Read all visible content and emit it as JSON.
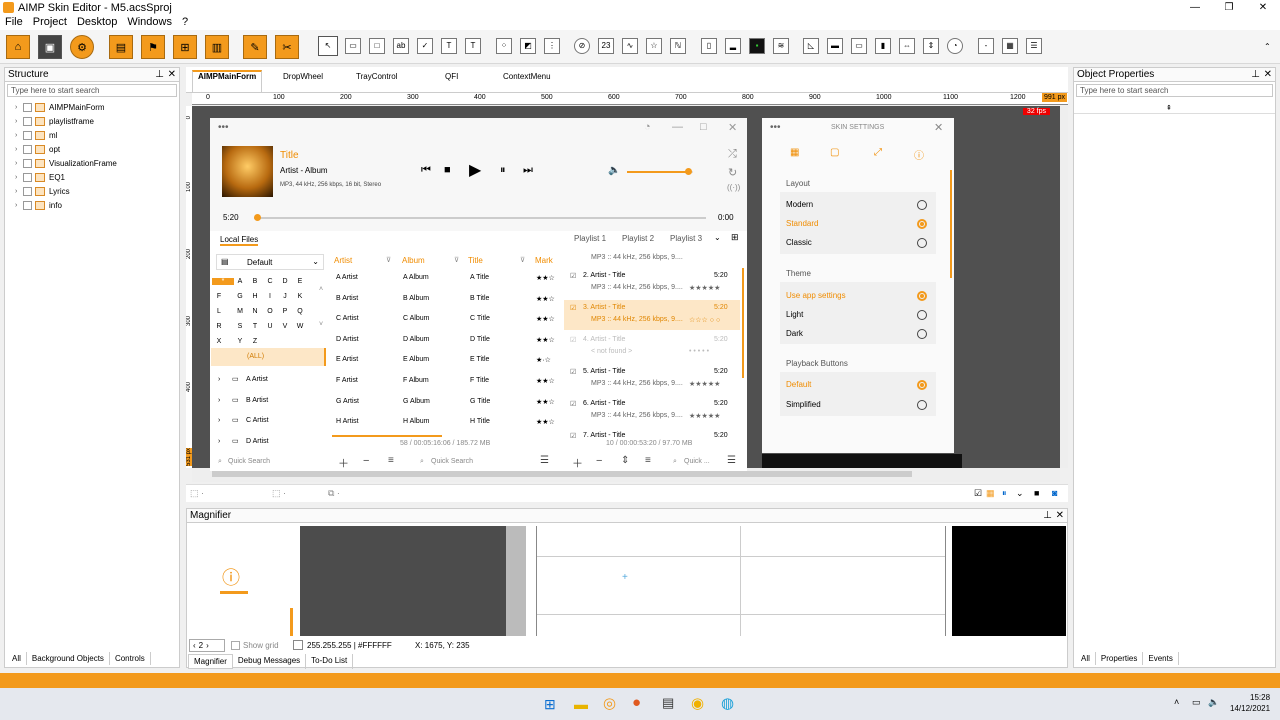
{
  "window": {
    "title": "AIMP Skin Editor - M5.acsSproj",
    "controls": [
      "—",
      "❐",
      "✕"
    ]
  },
  "menu": [
    "File",
    "Project",
    "Desktop",
    "Windows",
    "?"
  ],
  "structure": {
    "title": "Structure",
    "search_placeholder": "Type here to start search",
    "items": [
      "AIMPMainForm",
      "playlistframe",
      "ml",
      "opt",
      "VisualizationFrame",
      "EQ1",
      "Lyrics",
      "info"
    ],
    "bottom_tabs": [
      "All",
      "Background Objects",
      "Controls"
    ]
  },
  "doc_tabs": [
    "AIMPMainForm",
    "DropWheel",
    "TrayControl",
    "QFI",
    "ContextMenu"
  ],
  "ruler": {
    "ticks": [
      "0",
      "100",
      "200",
      "300",
      "400",
      "500",
      "600",
      "700",
      "800",
      "900",
      "1000",
      "1100",
      "1200"
    ],
    "end": "991 px",
    "vticks": [
      "0",
      "100",
      "200",
      "300",
      "400",
      "500"
    ],
    "vend": "531 px",
    "badge": "32 fps"
  },
  "player": {
    "title": "Title",
    "artist_album": "Artist - Album",
    "format": "MP3, 44 kHz, 256 kbps, 16 bit, Stereo",
    "time_elapsed": "5:20",
    "time_total": "0:00",
    "volume_fraction": 0.93,
    "progress_fraction": 0.0
  },
  "library": {
    "tab": "Local Files",
    "preset": "Default",
    "alphabet": [
      "*",
      "A",
      "B",
      "C",
      "D",
      "E",
      "F",
      "G",
      "H",
      "I",
      "J",
      "K",
      "L",
      "M",
      "N",
      "O",
      "P",
      "Q",
      "R",
      "S",
      "T",
      "U",
      "V",
      "W",
      "X",
      "Y",
      "Z"
    ],
    "all_label": "(ALL)",
    "artists": [
      "A Artist",
      "B Artist",
      "C Artist",
      "D Artist"
    ],
    "columns": [
      "Artist",
      "Album",
      "Title",
      "Mark"
    ],
    "rows": [
      [
        "A Artist",
        "A Album",
        "A Title",
        "★★☆"
      ],
      [
        "B Artist",
        "B Album",
        "B Title",
        "★★☆"
      ],
      [
        "C Artist",
        "C Album",
        "C Title",
        "★★☆"
      ],
      [
        "D Artist",
        "D Album",
        "D Title",
        "★★☆"
      ],
      [
        "E Artist",
        "E Album",
        "E Title",
        "★·☆"
      ],
      [
        "F Artist",
        "F Album",
        "F Title",
        "★★☆"
      ],
      [
        "G Artist",
        "G Album",
        "G Title",
        "★★☆"
      ],
      [
        "H Artist",
        "H Album",
        "H Title",
        "★★☆"
      ]
    ],
    "summary": "58 / 00:05:16:06 / 185.72 MB",
    "quick_search": "Quick Search",
    "quick_search2": "Quick Search"
  },
  "playlist": {
    "tabs": [
      "Playlist 1",
      "Playlist 2",
      "Playlist 3"
    ],
    "top_line": "MP3 :: 44 kHz, 256 kbps, 9....",
    "items": [
      {
        "title": "2. Artist - Title",
        "time": "5:20",
        "info": "MP3 :: 44 kHz, 256 kbps, 9....",
        "stars": "★★★★★"
      },
      {
        "title": "3. Artist - Title",
        "time": "5:20",
        "info": "MP3 :: 44 kHz, 256 kbps, 9....",
        "stars": "☆☆☆ ○ ○"
      },
      {
        "title": "4. Artist - Title",
        "time": "5:20",
        "info": "< not found >",
        "stars": "• • • • •"
      },
      {
        "title": "5. Artist - Title",
        "time": "5:20",
        "info": "MP3 :: 44 kHz, 256 kbps, 9....",
        "stars": "★★★★★"
      },
      {
        "title": "6. Artist - Title",
        "time": "5:20",
        "info": "MP3 :: 44 kHz, 256 kbps, 9....",
        "stars": "★★★★★"
      },
      {
        "title": "7. Artist - Title",
        "time": "5:20",
        "info": "",
        "stars": ""
      }
    ],
    "summary": "10 / 00:00:53:20 / 97.70 MB",
    "quick": "Quick ..."
  },
  "skin_settings": {
    "title": "SKIN SETTINGS",
    "layout_label": "Layout",
    "layout": [
      "Modern",
      "Standard",
      "Classic"
    ],
    "theme_label": "Theme",
    "theme": [
      "Use app settings",
      "Light",
      "Dark"
    ],
    "buttons_label": "Playback Buttons",
    "buttons": [
      "Default",
      "Simplified"
    ]
  },
  "magnifier": {
    "title": "Magnifier",
    "zoom": "2",
    "show_grid": "Show grid",
    "color": "255.255.255 | #FFFFFF",
    "coords": "X: 1675, Y: 235"
  },
  "mag_tabs": [
    "Magnifier",
    "Debug Messages",
    "To-Do List"
  ],
  "props": {
    "title": "Object Properties",
    "search_placeholder": "Type here to start search",
    "bottom_tabs": [
      "All",
      "Properties",
      "Events"
    ]
  },
  "clock": {
    "time": "15:28",
    "date": "14/12/2021"
  },
  "colors": {
    "accent": "#f39a1c",
    "canvas": "#505050"
  }
}
